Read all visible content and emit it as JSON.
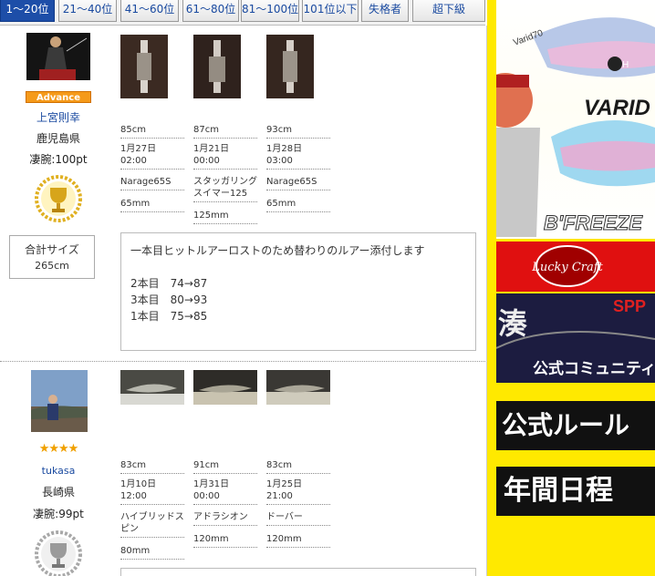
{
  "tabs": [
    {
      "label": "1〜20位",
      "active": true
    },
    {
      "label": "21〜40位",
      "active": false
    },
    {
      "label": "41〜60位",
      "active": false
    },
    {
      "label": "61〜80位",
      "active": false
    },
    {
      "label": "81〜100位",
      "active": false
    },
    {
      "label": "101位以下",
      "active": false
    },
    {
      "label": "失格者",
      "active": false
    },
    {
      "label": "超下級",
      "active": false
    }
  ],
  "entries": [
    {
      "badge": "Advance",
      "name": "上宮則幸",
      "prefecture": "鹿児島県",
      "score": "凄腕:100pt",
      "trophy": "gold-trophy-icon",
      "fish": [
        {
          "size": "85cm",
          "date": "1月27日",
          "time": "02:00",
          "lure": "Narage65S",
          "lure_size": "65mm"
        },
        {
          "size": "87cm",
          "date": "1月21日",
          "time": "00:00",
          "lure": "スタッガリング\nスイマー125",
          "lure_size": "125mm"
        },
        {
          "size": "93cm",
          "date": "1月28日",
          "time": "03:00",
          "lure": "Narage65S",
          "lure_size": "65mm"
        }
      ],
      "total_label": "合計サイズ",
      "total_value": "265cm",
      "comment": "一本目ヒットルアーロストのため替わりのルアー添付します\n\n2本目　74→87\n3本目　80→93\n1本目　75→85"
    },
    {
      "rating": "★★★★",
      "name": "tukasa",
      "prefecture": "長崎県",
      "score": "凄腕:99pt",
      "trophy": "silver-trophy-icon",
      "fish": [
        {
          "size": "83cm",
          "date": "1月10日",
          "time": "12:00",
          "lure": "ハイブリッドス\nピン",
          "lure_size": "80mm"
        },
        {
          "size": "91cm",
          "date": "1月31日",
          "time": "00:00",
          "lure": "アドラシオン",
          "lure_size": "120mm"
        },
        {
          "size": "83cm",
          "date": "1月25日",
          "time": "21:00",
          "lure": "ドーバー",
          "lure_size": "120mm"
        }
      ]
    }
  ],
  "side": {
    "lure_text_1": "VARID",
    "lure_text_2": "B'FREEZE",
    "lure_body_text": "Varid70",
    "lucky_text": "Lucky Craft",
    "spp_text_1": "SPP",
    "spp_text_2": "公式コミュニティ",
    "spp_kanji": "湊",
    "rules_text": "公式ルール",
    "schedule_text": "年間日程"
  },
  "colors": {
    "active_tab": "#1d4ea8",
    "link": "#1a4aa0",
    "side_yellow": "#ffe900",
    "banner_red": "#e01010",
    "gold_star": "#f0a000"
  }
}
